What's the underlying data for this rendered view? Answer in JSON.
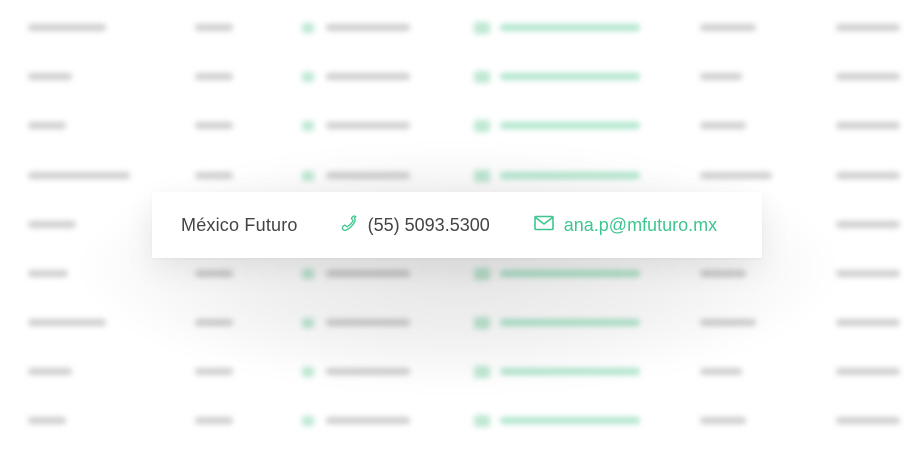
{
  "focused_row": {
    "organization": "México Futuro",
    "phone": "(55) 5093.5300",
    "email": "ana.p@mfuturo.mx",
    "phone_icon": "phone-icon",
    "email_icon": "mail-icon"
  },
  "colors": {
    "accent_green": "#3fc68f",
    "text_dark": "#444444",
    "blur_gray": "#c9c9c9",
    "blur_green": "#a9e3c8"
  }
}
